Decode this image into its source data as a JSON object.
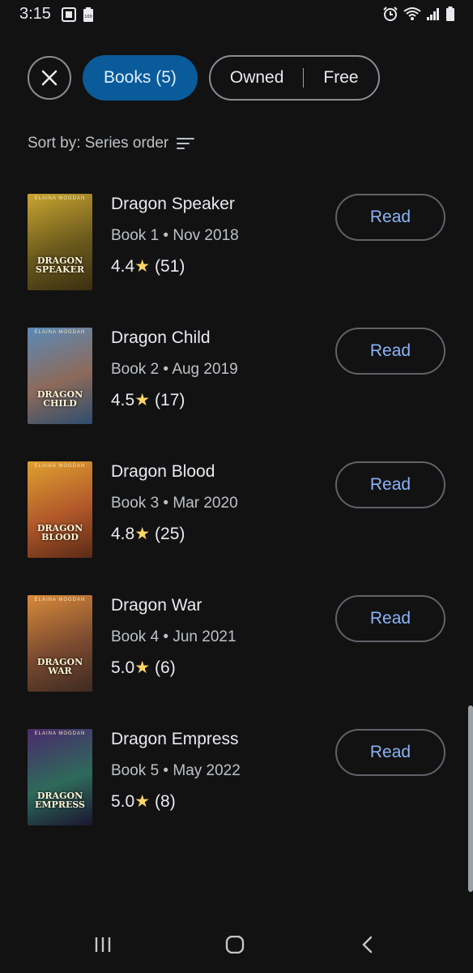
{
  "status_bar": {
    "time": "3:15",
    "battery_badge": "100",
    "icons": [
      "photo-icon",
      "battery-saver-icon",
      "alarm-icon",
      "wifi-icon",
      "signal-icon",
      "battery-icon"
    ]
  },
  "filters": {
    "close_icon": "close-icon",
    "books_chip": "Books (5)",
    "owned_label": "Owned",
    "free_label": "Free"
  },
  "sort": {
    "label": "Sort by: Series order",
    "icon": "sort-icon"
  },
  "books": [
    {
      "title": "Dragon Speaker",
      "meta": "Book 1 • Nov 2018",
      "rating": "4.4",
      "count": "(51)",
      "action": "Read",
      "cover_title": "DRAGON\nSPEAKER",
      "cover_author": "ELAINA MOGDAN",
      "cover_colors": [
        "#c9a431",
        "#6b5a1c",
        "#3a2f12"
      ]
    },
    {
      "title": "Dragon Child",
      "meta": "Book 2 • Aug 2019",
      "rating": "4.5",
      "count": "(17)",
      "action": "Read",
      "cover_title": "DRAGON\nCHILD",
      "cover_author": "ELAINA MOGDAN",
      "cover_colors": [
        "#5b8ab8",
        "#8c6a5a",
        "#2e4d6e"
      ]
    },
    {
      "title": "Dragon Blood",
      "meta": "Book 3 • Mar 2020",
      "rating": "4.8",
      "count": "(25)",
      "action": "Read",
      "cover_title": "DRAGON\nBLOOD",
      "cover_author": "ELAINA MOGDAN",
      "cover_colors": [
        "#e0a030",
        "#b0582a",
        "#5a2a16"
      ]
    },
    {
      "title": "Dragon War",
      "meta": "Book 4 • Jun 2021",
      "rating": "5.0",
      "count": "(6)",
      "action": "Read",
      "cover_title": "DRAGON\nWAR",
      "cover_author": "ELAINA MOGDAN",
      "cover_colors": [
        "#d98a3a",
        "#7a4a30",
        "#3e2a22"
      ]
    },
    {
      "title": "Dragon Empress",
      "meta": "Book 5 • May 2022",
      "rating": "5.0",
      "count": "(8)",
      "action": "Read",
      "cover_title": "DRAGON\nEMPRESS",
      "cover_author": "ELAINA MOGDAN",
      "cover_colors": [
        "#4a2a6e",
        "#2e6a5a",
        "#1a1630"
      ]
    }
  ],
  "nav": {
    "recents_icon": "recents-icon",
    "home_icon": "home-icon",
    "back_icon": "back-icon"
  },
  "colors": {
    "background": "#121212",
    "accent_chip": "#0a5b9a",
    "link_blue": "#8ab4f8",
    "star": "#fdd663"
  }
}
